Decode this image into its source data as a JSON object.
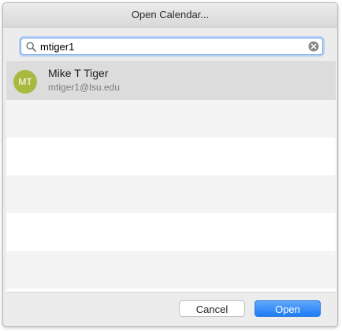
{
  "window": {
    "title": "Open Calendar..."
  },
  "search": {
    "value": "mtiger1",
    "icon": "search-icon",
    "clear_icon": "clear-icon"
  },
  "results": [
    {
      "initials": "MT",
      "name": "Mike T Tiger",
      "email": "mtiger1@lsu.edu",
      "avatar_color": "#a8b940",
      "selected": true
    }
  ],
  "buttons": {
    "cancel_label": "Cancel",
    "open_label": "Open"
  },
  "colors": {
    "accent": "#1f7cf5",
    "row_selected": "#dcdcdc",
    "row_alt": "#f4f4f4"
  }
}
